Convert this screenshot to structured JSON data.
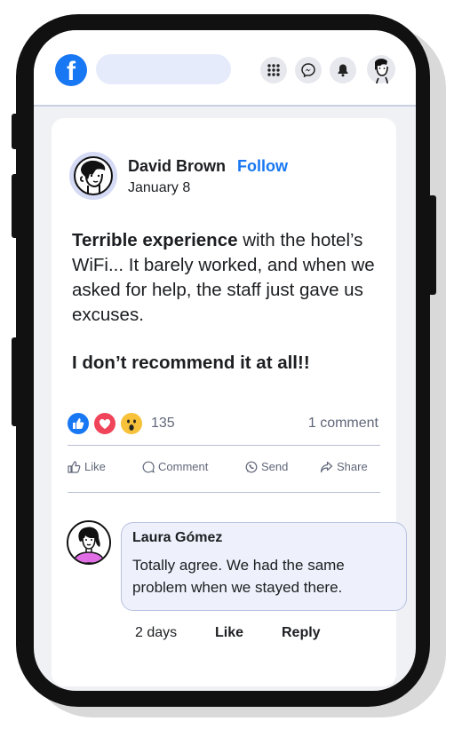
{
  "topbar": {
    "logo_letter": "f",
    "search_placeholder": "",
    "icons": [
      "grid-icon",
      "messenger-icon",
      "bell-icon",
      "profile-avatar"
    ]
  },
  "post": {
    "author": "David Brown",
    "follow_label": "Follow",
    "date": "January 8",
    "body_bold": "Terrible experience",
    "body_rest": " with the hotel’s WiFi... It barely worked, and when we asked for help, the staff just gave us excuses.",
    "recommend": "I don’t recommend it at all!!",
    "reaction_count": "135",
    "comment_count": "1 comment",
    "actions": {
      "like": "Like",
      "comment": "Comment",
      "send": "Send",
      "share": "Share"
    }
  },
  "comment": {
    "author": "Laura Gómez",
    "text": "Totally agree. We had the same problem when we stayed there.",
    "time": "2 days",
    "like_label": "Like",
    "reply_label": "Reply"
  },
  "colors": {
    "brand": "#1877f2",
    "like": "#1877f2",
    "love": "#f0445a",
    "wow": "#f7c23a"
  }
}
